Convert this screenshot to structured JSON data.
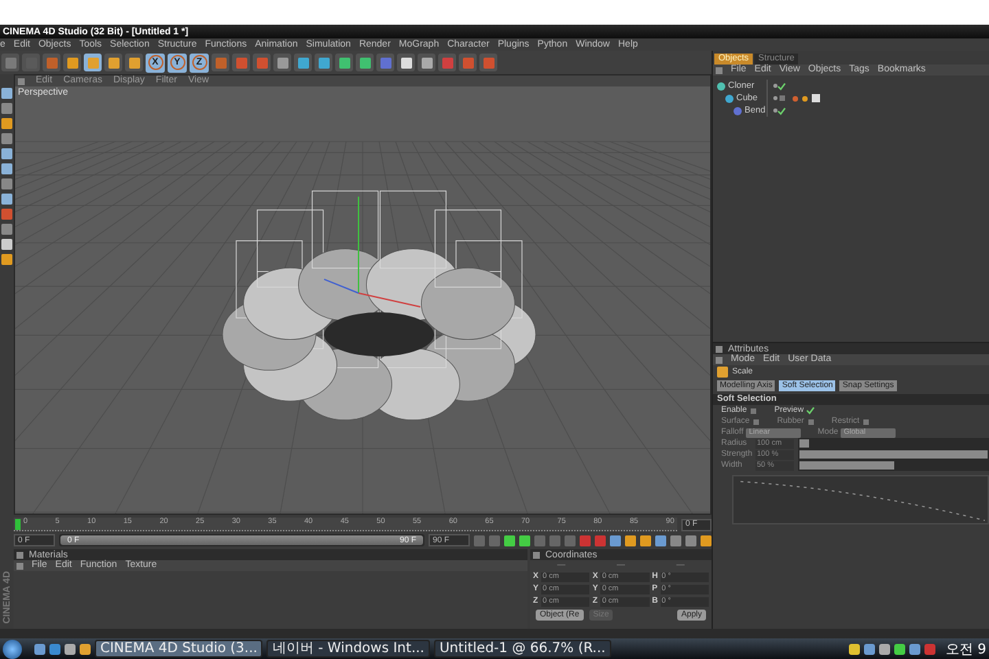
{
  "window": {
    "title": "CINEMA 4D Studio (32 Bit) - [Untitled 1 *]"
  },
  "menu": [
    "e",
    "Edit",
    "Objects",
    "Tools",
    "Selection",
    "Structure",
    "Functions",
    "Animation",
    "Simulation",
    "Render",
    "MoGraph",
    "Character",
    "Plugins",
    "Python",
    "Window",
    "Help"
  ],
  "toolbar": {
    "axis_buttons": [
      {
        "label": "X",
        "selected": true
      },
      {
        "label": "Y",
        "selected": true
      },
      {
        "label": "Z",
        "selected": true
      }
    ]
  },
  "viewport": {
    "menu": [
      "Edit",
      "Cameras",
      "Display",
      "Filter",
      "View"
    ],
    "camera": "Perspective"
  },
  "brand": "CINEMA 4D",
  "timeline": {
    "range": {
      "level": 1
    },
    "ticks": [
      "0",
      "5",
      "10",
      "15",
      "20",
      "25",
      "30",
      "35",
      "40",
      "45",
      "50",
      "55",
      "60",
      "65",
      "70",
      "75",
      "80",
      "85",
      "90"
    ],
    "current": "0 F",
    "start": "0 F",
    "range_start": "0 F",
    "range_end": "90 F",
    "end": "90 F"
  },
  "materials": {
    "title": "Materials",
    "menu": [
      "File",
      "Edit",
      "Function",
      "Texture"
    ]
  },
  "coordinates": {
    "title": "Coordinates",
    "headers": [
      "—",
      "—",
      "—"
    ],
    "rows": [
      {
        "a": "X",
        "va": "0 cm",
        "b": "X",
        "vb": "0 cm",
        "c": "H",
        "vc": "0 °"
      },
      {
        "a": "Y",
        "va": "0 cm",
        "b": "Y",
        "vb": "0 cm",
        "c": "P",
        "vc": "0 °"
      },
      {
        "a": "Z",
        "va": "0 cm",
        "b": "Z",
        "vb": "0 cm",
        "c": "B",
        "vc": "0 °"
      }
    ],
    "mode": "Object (Re",
    "size": "Size",
    "apply": "Apply"
  },
  "objects_panel": {
    "tabs": [
      {
        "label": "Objects",
        "selected": true
      },
      {
        "label": "Structure",
        "selected": false
      }
    ],
    "menu": [
      "File",
      "Edit",
      "View",
      "Objects",
      "Tags",
      "Bookmarks"
    ],
    "tree": [
      {
        "name": "Cloner",
        "checked": true,
        "tagged": false,
        "children": [
          {
            "name": "Cube",
            "checked": false,
            "tagged": true,
            "children": [
              {
                "name": "Bend",
                "checked": true,
                "tagged": false
              }
            ]
          }
        ]
      }
    ]
  },
  "attributes": {
    "title": "Attributes",
    "menu": [
      "Mode",
      "Edit",
      "User Data"
    ],
    "tool": "Scale",
    "tabs": [
      {
        "label": "Modelling Axis",
        "selected": false
      },
      {
        "label": "Soft Selection",
        "selected": true
      },
      {
        "label": "Snap Settings",
        "selected": false
      }
    ],
    "section": "Soft Selection",
    "option_rows": [
      [
        {
          "label": "Enable",
          "checked": false
        },
        {
          "label": "Preview",
          "checked": true
        }
      ],
      [
        {
          "label": "Surface",
          "checked": false
        },
        {
          "label": "Rubber",
          "checked": false
        },
        {
          "label": "Restrict",
          "checked": false
        }
      ]
    ],
    "dropdowns": [
      {
        "label": "Falloff",
        "value": "Linear"
      },
      {
        "label": "Mode",
        "value": "Global"
      }
    ],
    "sliders": [
      {
        "label": "Radius",
        "value": "100 cm",
        "level": 0.05
      },
      {
        "label": "Strength",
        "value": "100 %",
        "level": 1
      },
      {
        "label": "Width",
        "value": "50 %",
        "level": 0.5
      }
    ]
  },
  "taskbar": {
    "items": [
      {
        "label": "CINEMA 4D Studio (3...",
        "selected": true
      },
      {
        "label": "네이버 - Windows Int...",
        "selected": false
      },
      {
        "label": "Untitled-1 @ 66.7% (R...",
        "selected": false
      }
    ],
    "clock": "오전 9"
  }
}
